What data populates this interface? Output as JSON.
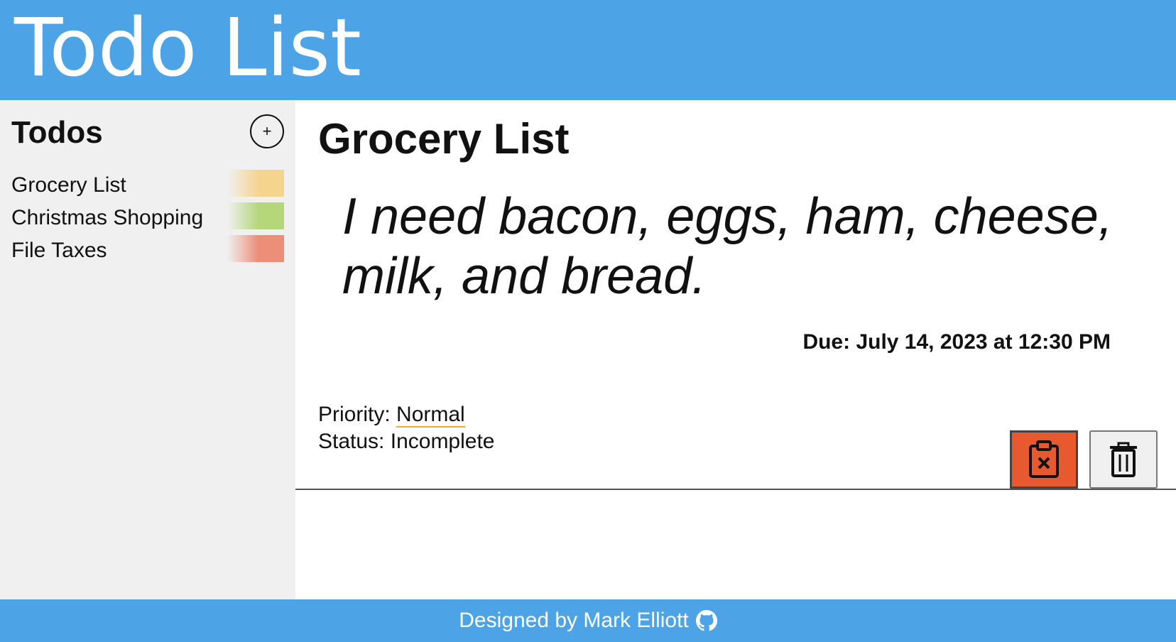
{
  "app": {
    "title": "Todo List"
  },
  "sidebar": {
    "title": "Todos",
    "add_icon": "plus-circle-icon",
    "items": [
      {
        "label": "Grocery List",
        "color": "#f5d48e"
      },
      {
        "label": "Christmas Shopping",
        "color": "#b6d67a"
      },
      {
        "label": "File Taxes",
        "color": "#ec8e78"
      }
    ]
  },
  "todo": {
    "title": "Grocery List",
    "description": "I need bacon, eggs, ham, cheese, milk, and bread.",
    "due": "Due: July 14, 2023 at 12:30 PM",
    "priority_label": "Priority:",
    "priority_value": "Normal",
    "status_label": "Status:",
    "status_value": "Incomplete",
    "mark_button_icon": "clipboard-x-icon",
    "delete_button_icon": "trash-icon"
  },
  "footer": {
    "text": "Designed by Mark Elliott",
    "icon": "github-icon"
  },
  "colors": {
    "header": "#4ca3e6",
    "sidebar_bg": "#f0f0f0",
    "incomplete_button": "#e7592f",
    "priority_underline": "#f0a830"
  }
}
